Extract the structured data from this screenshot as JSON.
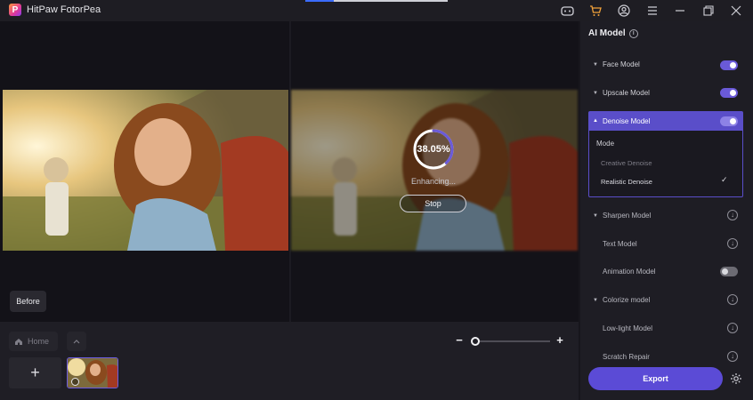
{
  "app": {
    "title": "HitPaw FotorPea"
  },
  "window_controls": {
    "minimize": "—",
    "maximize": "❐",
    "close": "✕"
  },
  "preview": {
    "progress_value": 0.3805,
    "progress_text": "38.05%",
    "status_text": "Enhancing...",
    "stop_label": "Stop",
    "before_label": "Before"
  },
  "bottom": {
    "home_label": "Home",
    "add_label": "+",
    "zoom_minus": "−",
    "zoom_plus": "+",
    "zoom_level": 0.0
  },
  "panel": {
    "title": "AI Model",
    "models": [
      {
        "label": "Face Model",
        "state": "on"
      },
      {
        "label": "Upscale Model",
        "state": "on"
      },
      {
        "label": "Denoise Model",
        "state": "on"
      },
      {
        "label": "Sharpen Model",
        "state": "download"
      },
      {
        "label": "Text Model",
        "state": "download"
      },
      {
        "label": "Animation Model",
        "state": "off"
      },
      {
        "label": "Colorize model",
        "state": "download"
      },
      {
        "label": "Low-light Model",
        "state": "download"
      },
      {
        "label": "Scratch Repair",
        "state": "download"
      }
    ],
    "denoise_mode": {
      "label": "Mode",
      "options": [
        "Creative Denoise",
        "Realistic Denoise"
      ],
      "selected": "Realistic Denoise"
    },
    "export_label": "Export"
  },
  "colors": {
    "accent": "#5b4bd6",
    "panel_bg": "#1e1d24",
    "workspace_bg": "#131218"
  }
}
